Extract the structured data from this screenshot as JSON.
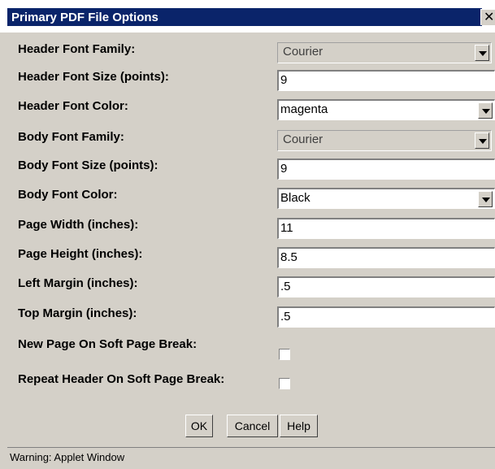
{
  "dialog": {
    "title": "Primary PDF File Options",
    "close_glyph": "✕"
  },
  "form": {
    "header_font_family": {
      "label": "Header Font Family:",
      "value": "Courier",
      "enabled": false
    },
    "header_font_size": {
      "label": "Header Font Size (points):",
      "value": "9"
    },
    "header_font_color": {
      "label": "Header Font Color:",
      "value": "magenta"
    },
    "body_font_family": {
      "label": "Body Font Family:",
      "value": "Courier",
      "enabled": false
    },
    "body_font_size": {
      "label": "Body Font Size (points):",
      "value": "9"
    },
    "body_font_color": {
      "label": "Body Font Color:",
      "value": "Black"
    },
    "page_width": {
      "label": "Page Width (inches):",
      "value": "11"
    },
    "page_height": {
      "label": "Page Height (inches):",
      "value": "8.5"
    },
    "left_margin": {
      "label": "Left Margin (inches):",
      "value": ".5"
    },
    "top_margin": {
      "label": "Top Margin (inches):",
      "value": ".5"
    },
    "new_page_soft_break": {
      "label": "New Page On Soft Page Break:",
      "checked": false
    },
    "repeat_header_soft_break": {
      "label": "Repeat Header On Soft Page Break:",
      "checked": false
    }
  },
  "buttons": {
    "ok": "OK",
    "cancel": "Cancel",
    "help": "Help"
  },
  "status": "Warning: Applet Window",
  "colors": {
    "title_bar": "#0a246a",
    "dialog_bg": "#d4d0c8"
  }
}
